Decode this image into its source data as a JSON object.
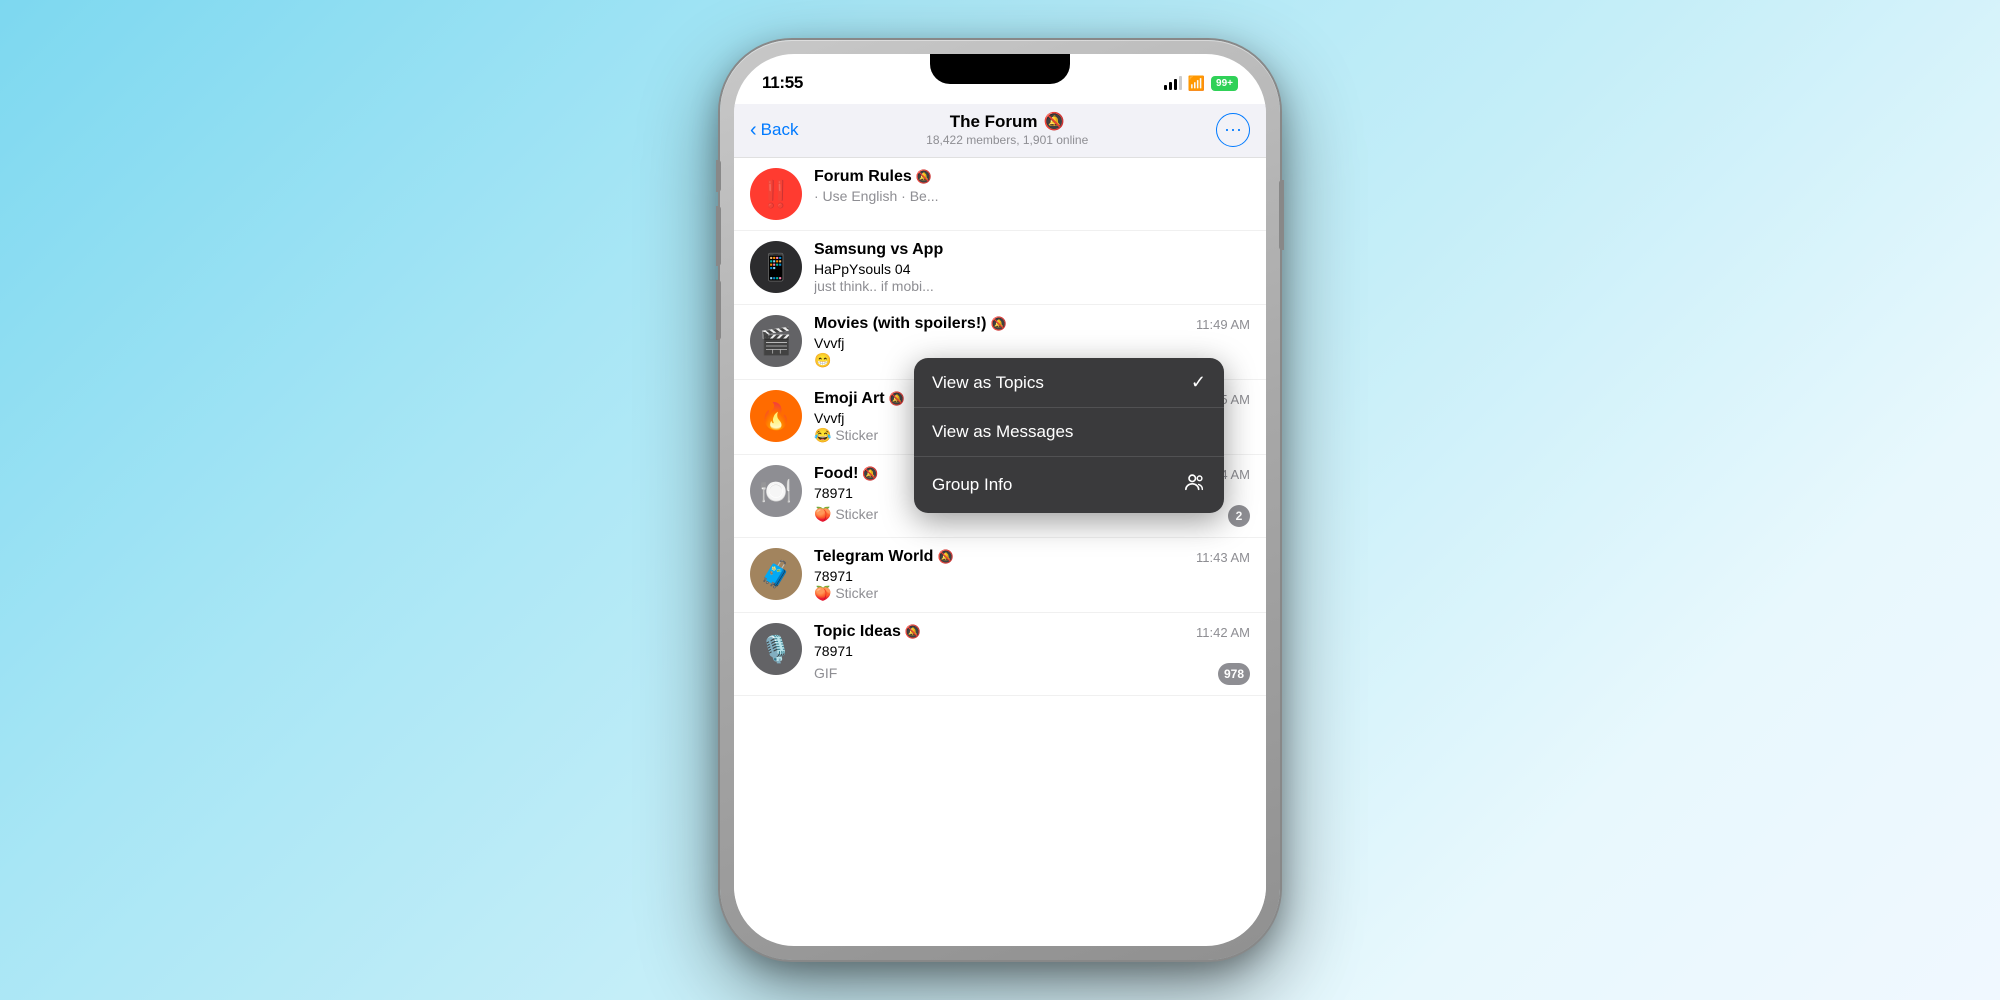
{
  "background": {
    "gradient": "light blue to white"
  },
  "phone": {
    "status_bar": {
      "time": "11:55",
      "battery": "99+",
      "battery_color": "#30d158"
    },
    "header": {
      "back_label": "Back",
      "title": "The Forum",
      "muted_icon": "🔇",
      "subtitle": "18,422 members, 1,901 online"
    },
    "context_menu": {
      "items": [
        {
          "label": "View as Topics",
          "icon": "checkmark",
          "checked": true
        },
        {
          "label": "View as Messages",
          "icon": null,
          "checked": false
        },
        {
          "label": "Group Info",
          "icon": "group",
          "checked": false
        }
      ]
    },
    "chat_list": {
      "items": [
        {
          "id": "forum-rules",
          "name": "Forum Rules",
          "muted": true,
          "avatar_emoji": "‼️",
          "avatar_bg": "red",
          "sender": "",
          "preview": "· Use English · Be...",
          "time": "",
          "unread": null
        },
        {
          "id": "samsung-vs-app",
          "name": "Samsung vs App",
          "muted": false,
          "avatar_emoji": "📱",
          "avatar_bg": "#1c1c1e",
          "sender": "HaPpYsouls 04",
          "preview": "just think.. if mobi...",
          "time": "",
          "unread": null
        },
        {
          "id": "movies",
          "name": "Movies (with spoilers!)",
          "muted": true,
          "avatar_emoji": "🎬",
          "avatar_bg": "#636366",
          "sender": "Vvvfj",
          "preview": "😁",
          "time": "11:49 AM",
          "unread": null
        },
        {
          "id": "emoji-art",
          "name": "Emoji Art",
          "muted": true,
          "avatar_emoji": "🔥",
          "avatar_bg": "#ff9500",
          "sender": "Vvvfj",
          "preview": "😂 Sticker",
          "time": "11:45 AM",
          "unread": null
        },
        {
          "id": "food",
          "name": "Food!",
          "muted": true,
          "avatar_emoji": "🍽️",
          "avatar_bg": "#8e8e93",
          "sender": "78971",
          "preview": "🍑 Sticker",
          "time": "11:44 AM",
          "unread": 2
        },
        {
          "id": "telegram-world",
          "name": "Telegram World",
          "muted": true,
          "avatar_emoji": "🧳",
          "avatar_bg": "#a2845e",
          "sender": "78971",
          "preview": "🍑 Sticker",
          "time": "11:43 AM",
          "unread": null
        },
        {
          "id": "topic-ideas",
          "name": "Topic Ideas",
          "muted": true,
          "avatar_emoji": "🎙️",
          "avatar_bg": "#636366",
          "sender": "78971",
          "preview": "GIF",
          "time": "11:42 AM",
          "unread": 978
        }
      ]
    }
  }
}
